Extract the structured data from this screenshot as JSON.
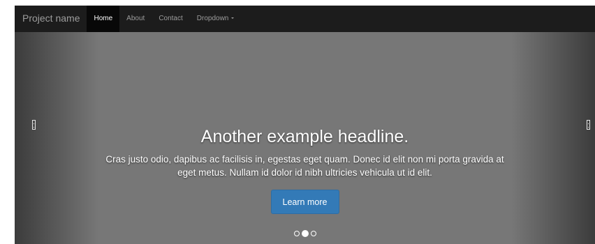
{
  "navbar": {
    "brand": "Project name",
    "items": [
      {
        "label": "Home",
        "active": true
      },
      {
        "label": "About"
      },
      {
        "label": "Contact"
      },
      {
        "label": "Dropdown",
        "caret": true
      }
    ]
  },
  "carousel": {
    "headline": "Another example headline.",
    "body": "Cras justo odio, dapibus ac facilisis in, egestas eget quam. Donec id elit non mi porta gravida at eget metus. Nullam id dolor id nibh ultricies vehicula ut id elit.",
    "button_label": "Learn more",
    "prev_icon": "chevron-left-icon",
    "next_icon": "chevron-right-icon",
    "slides_count": 3,
    "active_slide": 2
  },
  "colors": {
    "navbar_bg": "#1c1c1c",
    "carousel_bg": "#777777",
    "button_bg": "#337ab7"
  }
}
